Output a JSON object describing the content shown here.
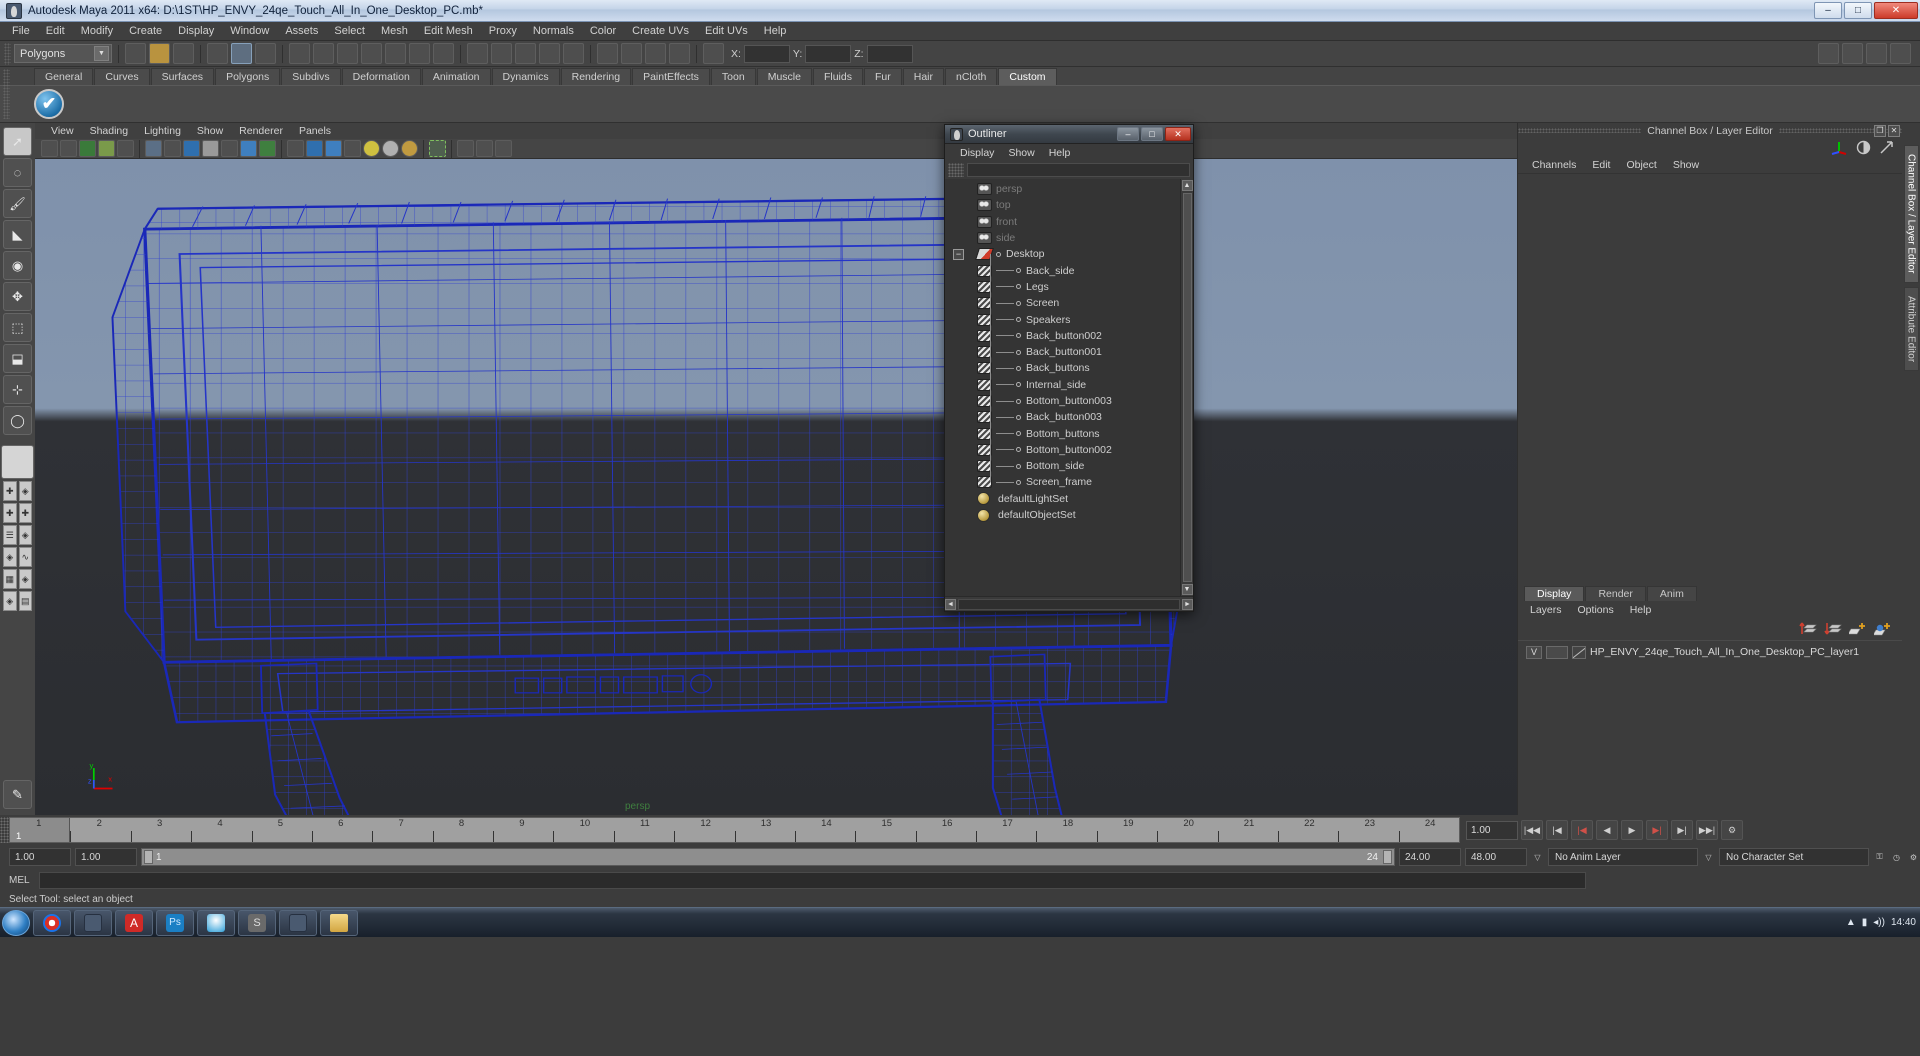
{
  "window": {
    "title": "Autodesk Maya 2011 x64: D:\\1ST\\HP_ENVY_24qe_Touch_All_In_One_Desktop_PC.mb*",
    "minimize": "–",
    "maximize": "□",
    "close": "✕"
  },
  "menubar": [
    "File",
    "Edit",
    "Modify",
    "Create",
    "Display",
    "Window",
    "Assets",
    "Select",
    "Mesh",
    "Edit Mesh",
    "Proxy",
    "Normals",
    "Color",
    "Create UVs",
    "Edit UVs",
    "Help"
  ],
  "statusline": {
    "mode": "Polygons",
    "mode_arrow": "▼",
    "x_label": "X:",
    "y_label": "Y:",
    "z_label": "Z:",
    "x_value": "",
    "y_value": "",
    "z_value": ""
  },
  "shelf": {
    "tabs": [
      "General",
      "Curves",
      "Surfaces",
      "Polygons",
      "Subdivs",
      "Deformation",
      "Animation",
      "Dynamics",
      "Rendering",
      "PaintEffects",
      "Toon",
      "Muscle",
      "Fluids",
      "Fur",
      "Hair",
      "nCloth",
      "Custom"
    ],
    "active_tab": "Custom",
    "item_icon": "checkmark-shelf-icon",
    "item_glyph": "✔"
  },
  "viewport": {
    "menus": [
      "View",
      "Shading",
      "Lighting",
      "Show",
      "Renderer",
      "Panels"
    ],
    "camera_label": "persp",
    "axis": {
      "y": "y",
      "x": "x",
      "z": "z"
    }
  },
  "outliner": {
    "title": "Outliner",
    "minimize": "–",
    "maximize": "□",
    "close": "✕",
    "menus": [
      "Display",
      "Show",
      "Help"
    ],
    "search_value": "",
    "cameras": [
      {
        "label": "persp",
        "icon": "camera-icon"
      },
      {
        "label": "top",
        "icon": "camera-icon"
      },
      {
        "label": "front",
        "icon": "camera-icon"
      },
      {
        "label": "side",
        "icon": "camera-icon"
      }
    ],
    "group": {
      "label": "Desktop",
      "icon": "group-icon",
      "expander": "−"
    },
    "children": [
      "Back_side",
      "Legs",
      "Screen",
      "Speakers",
      "Back_button002",
      "Back_button001",
      "Back_buttons",
      "Internal_side",
      "Bottom_button003",
      "Back_button003",
      "Bottom_buttons",
      "Bottom_button002",
      "Bottom_side",
      "Screen_frame"
    ],
    "sets": [
      {
        "label": "defaultLightSet",
        "icon": "set-icon"
      },
      {
        "label": "defaultObjectSet",
        "icon": "set-icon"
      }
    ],
    "scroll_up": "▲",
    "scroll_down": "▼",
    "scroll_left": "◄",
    "scroll_right": "►"
  },
  "channelbox": {
    "title": "Channel Box / Layer Editor",
    "restore_glyph": "❐",
    "close_glyph": "✕",
    "menus": [
      "Channels",
      "Edit",
      "Object",
      "Show"
    ]
  },
  "layereditor": {
    "tabs": [
      "Display",
      "Render",
      "Anim"
    ],
    "active_tab": "Display",
    "menus": [
      "Layers",
      "Options",
      "Help"
    ],
    "layer": {
      "visibility": "V",
      "name": "HP_ENVY_24qe_Touch_All_In_One_Desktop_PC_layer1"
    }
  },
  "sidetabs": [
    {
      "label": "Channel Box / Layer Editor",
      "active": true
    },
    {
      "label": "Attribute Editor",
      "active": false
    }
  ],
  "timeline": {
    "ticks": [
      "1",
      "2",
      "3",
      "4",
      "5",
      "6",
      "7",
      "8",
      "9",
      "10",
      "11",
      "12",
      "13",
      "14",
      "15",
      "16",
      "17",
      "18",
      "19",
      "20",
      "21",
      "22",
      "23",
      "24"
    ],
    "current_frame": "1",
    "current_field": "1.00",
    "playback_buttons": [
      "|◀◀",
      "|◀",
      "|◀",
      "◀",
      "▶",
      "▶|",
      "▶|"
    ]
  },
  "range": {
    "start": "1.00",
    "end": "1.00",
    "range_start": "1",
    "range_end": "24",
    "anim_start": "24.00",
    "anim_end": "48.00",
    "anim_layer": "No Anim Layer",
    "character_set": "No Character Set"
  },
  "mel": {
    "label": "MEL",
    "value": ""
  },
  "status": {
    "text": "Select Tool: select an object"
  },
  "taskbar": {
    "clock_time": "14:40",
    "clock_date": ""
  }
}
